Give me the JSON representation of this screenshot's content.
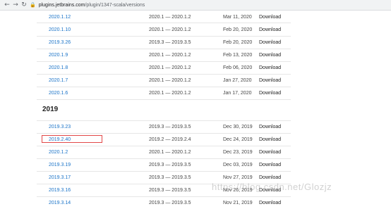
{
  "browser": {
    "url_domain": "plugins.jetbrains.com",
    "url_path": "/plugin/1347-scala/versions",
    "lock_glyph": "🔒",
    "back_glyph": "←",
    "forward_glyph": "→",
    "reload_glyph": "↻"
  },
  "rows_2020": [
    {
      "version": "2020.1.12",
      "range": "2020.1 — 2020.1.2",
      "date": "Mar 11, 2020",
      "action": "Download"
    },
    {
      "version": "2020.1.10",
      "range": "2020.1 — 2020.1.2",
      "date": "Feb 20, 2020",
      "action": "Download"
    },
    {
      "version": "2019.3.26",
      "range": "2019.3 — 2019.3.5",
      "date": "Feb 20, 2020",
      "action": "Download"
    },
    {
      "version": "2020.1.9",
      "range": "2020.1 — 2020.1.2",
      "date": "Feb 13, 2020",
      "action": "Download"
    },
    {
      "version": "2020.1.8",
      "range": "2020.1 — 2020.1.2",
      "date": "Feb 06, 2020",
      "action": "Download"
    },
    {
      "version": "2020.1.7",
      "range": "2020.1 — 2020.1.2",
      "date": "Jan 27, 2020",
      "action": "Download"
    },
    {
      "version": "2020.1.6",
      "range": "2020.1 — 2020.1.2",
      "date": "Jan 17, 2020",
      "action": "Download"
    }
  ],
  "section_2019": {
    "title": "2019"
  },
  "rows_2019": [
    {
      "version": "2019.3.23",
      "range": "2019.3 — 2019.3.5",
      "date": "Dec 30, 2019",
      "action": "Download"
    },
    {
      "version": "2019.2.40",
      "range": "2019.2 — 2019.2.4",
      "date": "Dec 24, 2019",
      "action": "Download"
    },
    {
      "version": "2020.1.2",
      "range": "2020.1 — 2020.1.2",
      "date": "Dec 23, 2019",
      "action": "Download"
    },
    {
      "version": "2019.3.19",
      "range": "2019.3 — 2019.3.5",
      "date": "Dec 03, 2019",
      "action": "Download"
    },
    {
      "version": "2019.3.17",
      "range": "2019.3 — 2019.3.5",
      "date": "Nov 27, 2019",
      "action": "Download"
    },
    {
      "version": "2019.3.16",
      "range": "2019.3 — 2019.3.5",
      "date": "Nov 26, 2019",
      "action": "Download"
    },
    {
      "version": "2019.3.14",
      "range": "2019.3 — 2019.3.5",
      "date": "Nov 21, 2019",
      "action": "Download"
    }
  ],
  "watermark": "https://blog.csdn.net/Glozjz",
  "colors": {
    "link": "#1a73c8",
    "highlight": "#e34848"
  }
}
